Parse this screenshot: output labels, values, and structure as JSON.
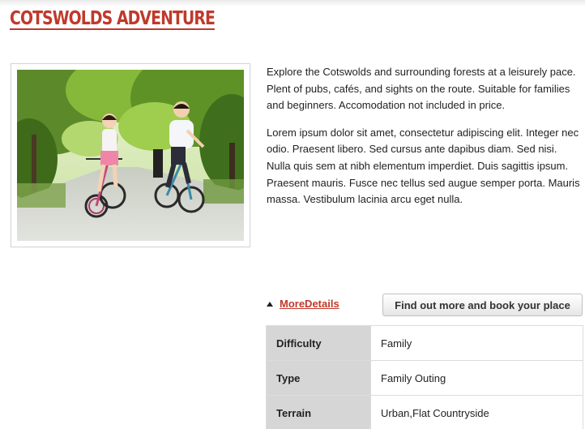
{
  "page": {
    "title": "COTSWOLDS ADVENTURE"
  },
  "description": {
    "paragraphs": [
      "Explore the Cotswolds and surrounding forests at a leisurely pace. Plent of pubs, cafés, and sights on the route. Suitable for families and beginners. Accomodation not included in price.",
      "Lorem ipsum dolor sit amet, consectetur adipiscing elit. Integer nec odio. Praesent libero. Sed cursus ante dapibus diam. Sed nisi. Nulla quis sem at nibh elementum imperdiet. Duis sagittis ipsum. Praesent mauris. Fusce nec tellus sed augue semper porta. Mauris massa. Vestibulum lacinia arcu eget nulla."
    ]
  },
  "actions": {
    "more_details_label": "MoreDetails",
    "book_label": "Find out more and book your place"
  },
  "details": [
    {
      "label": "Difficulty",
      "value": "Family"
    },
    {
      "label": "Type",
      "value": "Family Outing"
    },
    {
      "label": "Terrain",
      "value": "Urban,Flat Countryside"
    }
  ],
  "colors": {
    "accent": "#c0392b",
    "table_label_bg": "#d6d6d6"
  },
  "icons": {
    "more_details": "triangle-up-icon"
  }
}
